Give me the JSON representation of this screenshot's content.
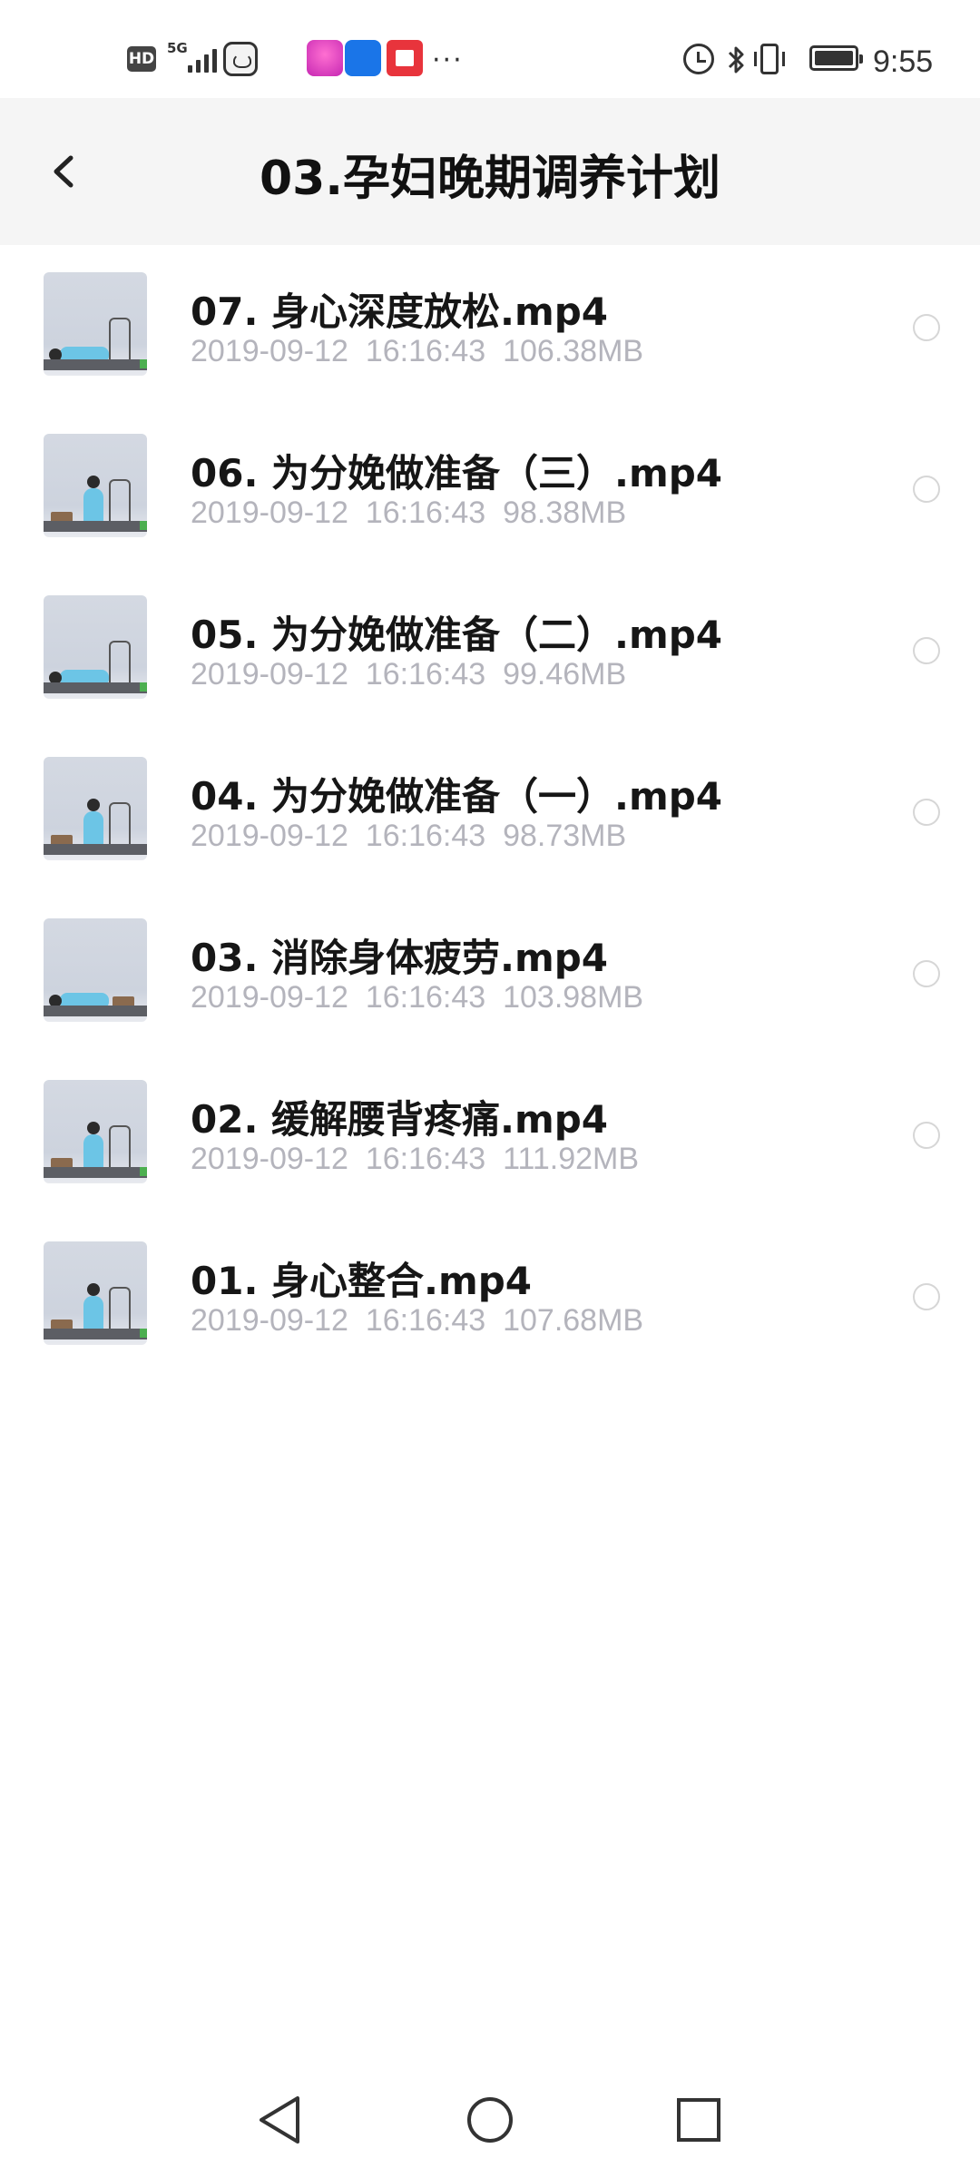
{
  "status_bar": {
    "hd": "HD",
    "network": "5G",
    "more": "···",
    "time": "9:55",
    "icons": [
      "hd-icon",
      "signal-icon",
      "face-app-icon",
      "shopping-app-icon",
      "alipay-app-icon",
      "reader-app-icon",
      "alarm-icon",
      "bluetooth-icon",
      "vibrate-icon",
      "battery-icon"
    ]
  },
  "header": {
    "title": "03.孕妇晚期调养计划",
    "back_icon": "chevron-left-icon"
  },
  "files": [
    {
      "name": "07. 身心深度放松.mp4",
      "date": "2019-09-12",
      "time": "16:16:43",
      "size": "106.38MB",
      "pose": "lying"
    },
    {
      "name": "06. 为分娩做准备（三）.mp4",
      "date": "2019-09-12",
      "time": "16:16:43",
      "size": "98.38MB",
      "pose": "sitting"
    },
    {
      "name": "05. 为分娩做准备（二）.mp4",
      "date": "2019-09-12",
      "time": "16:16:43",
      "size": "99.46MB",
      "pose": "lying"
    },
    {
      "name": "04. 为分娩做准备（一）.mp4",
      "date": "2019-09-12",
      "time": "16:16:43",
      "size": "98.73MB",
      "pose": "sitting"
    },
    {
      "name": "03. 消除身体疲劳.mp4",
      "date": "2019-09-12",
      "time": "16:16:43",
      "size": "103.98MB",
      "pose": "lying"
    },
    {
      "name": "02. 缓解腰背疼痛.mp4",
      "date": "2019-09-12",
      "time": "16:16:43",
      "size": "111.92MB",
      "pose": "sitting"
    },
    {
      "name": "01. 身心整合.mp4",
      "date": "2019-09-12",
      "time": "16:16:43",
      "size": "107.68MB",
      "pose": "sitting"
    }
  ],
  "nav_bar": {
    "icons": [
      "nav-back-icon",
      "nav-home-icon",
      "nav-recent-icon"
    ]
  },
  "colors": {
    "header_bg": "#f5f5f5",
    "meta_text": "#b4b4bc",
    "title_text": "#111111",
    "radio_border": "#d6d6d6"
  }
}
